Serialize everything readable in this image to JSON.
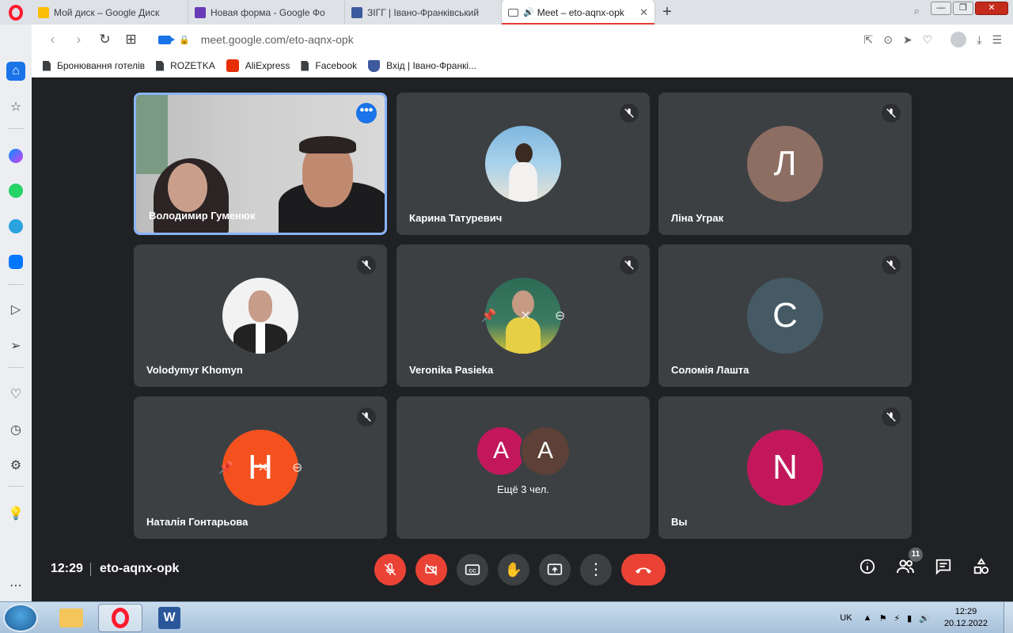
{
  "browser": {
    "tabs": [
      {
        "title": "Мой диск – Google Диск",
        "color": "#fbbc04"
      },
      {
        "title": "Новая форма - Google Фо",
        "color": "#673ab7"
      },
      {
        "title": "ЗІГГ | Івано-Франківський",
        "color": "#3d5a9e"
      },
      {
        "title": "Meet – eto-aqnx-opk",
        "color": "#1a73e8",
        "active": true
      }
    ],
    "url": "meet.google.com/eto-aqnx-opk",
    "bookmarks": [
      {
        "label": "Бронювання готелів"
      },
      {
        "label": "ROZETKA"
      },
      {
        "label": "AliExpress"
      },
      {
        "label": "Facebook"
      },
      {
        "label": "Вхід | Івано-Франкі..."
      }
    ]
  },
  "meet": {
    "tiles": [
      {
        "name": "Володимир Гуменюк",
        "kind": "video"
      },
      {
        "name": "Карина Татуревич",
        "kind": "photo"
      },
      {
        "name": "Ліна Уграк",
        "kind": "letter",
        "letter": "Л",
        "color": "#8d6e63"
      },
      {
        "name": "Volodymyr Khomyn",
        "kind": "photo"
      },
      {
        "name": "Veronika Pasieka",
        "kind": "photo"
      },
      {
        "name": "Соломія Лашта",
        "kind": "letter",
        "letter": "С",
        "color": "#455a64"
      },
      {
        "name": "Наталія Гонтарьова",
        "kind": "letter",
        "letter": "Н",
        "color": "#f4511e"
      },
      {
        "name": "",
        "kind": "more",
        "letters": [
          "А",
          "А"
        ],
        "colors": [
          "#c2185b",
          "#5d4037"
        ],
        "label": "Ещё 3 чел."
      },
      {
        "name": "Вы",
        "kind": "letter",
        "letter": "N",
        "color": "#c2185b"
      }
    ],
    "time": "12:29",
    "meeting_code": "eto-aqnx-opk",
    "participants_count": "11"
  },
  "taskbar": {
    "lang": "UK",
    "time": "12:29",
    "date": "20.12.2022"
  }
}
